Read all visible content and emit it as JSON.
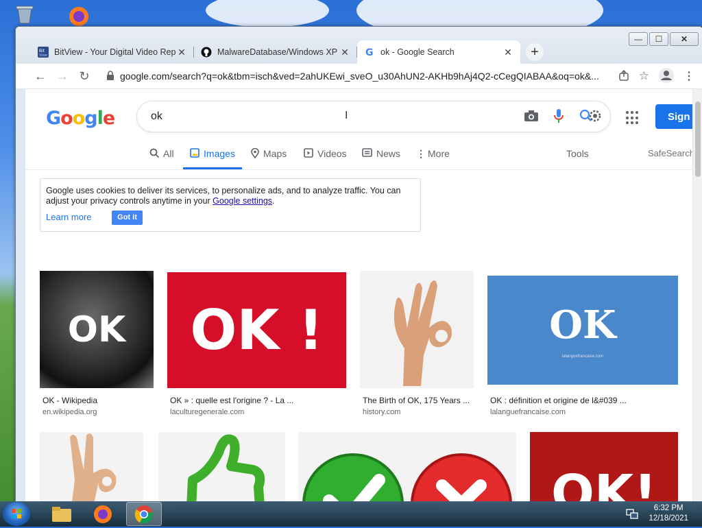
{
  "browser": {
    "tabs": [
      {
        "label": "BitView - Your Digital Video Repo",
        "icon": "bitview-icon",
        "active": false
      },
      {
        "label": "MalwareDatabase/Windows XP H",
        "icon": "github-icon",
        "active": false
      },
      {
        "label": "ok - Google Search",
        "icon": "google-g-icon",
        "active": true
      }
    ],
    "url": "google.com/search?q=ok&tbm=isch&ved=2ahUKEwi_sveO_u30AhUN2-AKHb9hAj4Q2-cCegQIABAA&oq=ok&..."
  },
  "google": {
    "logo": "Google",
    "query": "ok",
    "signin_label": "Sign i",
    "tabs": [
      {
        "label": "All",
        "icon": "search-icon"
      },
      {
        "label": "Images",
        "icon": "image-icon",
        "selected": true
      },
      {
        "label": "Maps",
        "icon": "map-pin-icon"
      },
      {
        "label": "Videos",
        "icon": "play-icon"
      },
      {
        "label": "News",
        "icon": "news-icon"
      },
      {
        "label": "More",
        "icon": "more-dots-icon"
      }
    ],
    "tools_label": "Tools",
    "safesearch_label": "SafeSearch",
    "cookie": {
      "text": "Google uses cookies to deliver its services, to personalize ads, and to analyze traffic. You can adjust your privacy controls anytime in your ",
      "link": "Google settings",
      "period": ".",
      "learn_more": "Learn more",
      "got_it": "Got it"
    },
    "results": [
      {
        "title": "OK - Wikipedia",
        "domain": "en.wikipedia.org",
        "image_text": "OK"
      },
      {
        "title": "OK » : quelle est l'origine ? - La ...",
        "domain": "laculturegenerale.com",
        "image_text": "OK !"
      },
      {
        "title": "The Birth of OK, 175 Years ...",
        "domain": "history.com",
        "image_text": ""
      },
      {
        "title": "OK : définition et origine de l&#039 ...",
        "domain": "lalanguefrancaise.com",
        "image_text": "OK",
        "image_subtext": "lalanguefrancaise.com"
      },
      {
        "title": "",
        "domain": "",
        "image_text": ""
      },
      {
        "title": "",
        "domain": "",
        "image_text": ""
      },
      {
        "title": "",
        "domain": "",
        "image_text": ""
      },
      {
        "title": "",
        "domain": "",
        "image_text": "OK!"
      }
    ]
  },
  "taskbar": {
    "time": "6:32 PM",
    "date": "12/18/2021"
  },
  "colors": {
    "google_blue": "#1a73e8",
    "ok_red": "#d50f2a",
    "ok_blue": "#4a88cc",
    "check_green": "#2fae2f",
    "cross_red": "#e32b2b"
  }
}
